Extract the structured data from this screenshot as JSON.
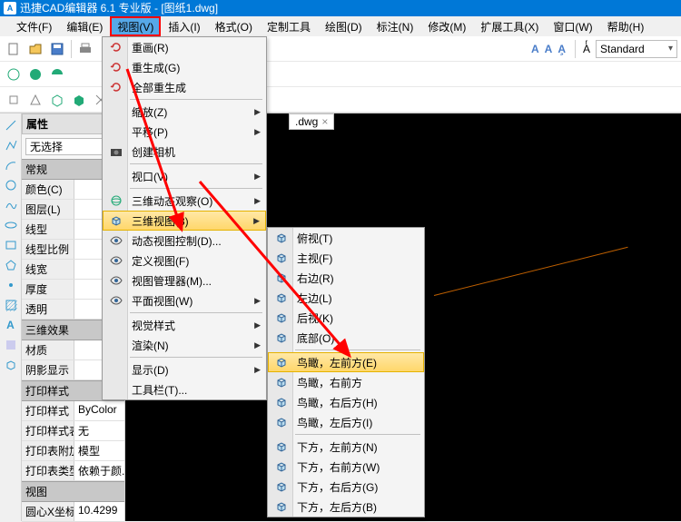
{
  "title": "迅捷CAD编辑器 6.1 专业版  - [图纸1.dwg]",
  "menubar": [
    "文件(F)",
    "编辑(E)",
    "视图(V)",
    "插入(I)",
    "格式(O)",
    "定制工具",
    "绘图(D)",
    "标注(N)",
    "修改(M)",
    "扩展工具(X)",
    "窗口(W)",
    "帮助(H)"
  ],
  "highlight_menu_index": 2,
  "style_combo": "Standard",
  "tab": {
    "label": ".dwg",
    "close": "×"
  },
  "props": {
    "panel_title": "属性",
    "noselect": "无选择",
    "sections": [
      {
        "head": "常规",
        "rows": [
          {
            "k": "颜色(C)",
            "v": ""
          },
          {
            "k": "图层(L)",
            "v": ""
          },
          {
            "k": "线型",
            "v": ""
          },
          {
            "k": "线型比例",
            "v": ""
          },
          {
            "k": "线宽",
            "v": ""
          },
          {
            "k": "厚度",
            "v": ""
          },
          {
            "k": "透明",
            "v": ""
          }
        ]
      },
      {
        "head": "三维效果",
        "rows": [
          {
            "k": "材质",
            "v": ""
          },
          {
            "k": "阴影显示",
            "v": ""
          }
        ]
      },
      {
        "head": "打印样式",
        "rows": [
          {
            "k": "打印样式",
            "v": "ByColor"
          },
          {
            "k": "打印样式表",
            "v": "无"
          },
          {
            "k": "打印表附加到",
            "v": "模型"
          },
          {
            "k": "打印表类型",
            "v": "依赖于颜..."
          }
        ]
      },
      {
        "head": "视图",
        "rows": [
          {
            "k": "圆心X坐标",
            "v": "10.4299"
          }
        ]
      }
    ]
  },
  "view_menu": {
    "items": [
      {
        "icon": "redo",
        "label": "重画(R)"
      },
      {
        "icon": "regen",
        "label": "重生成(G)"
      },
      {
        "icon": "regenall",
        "label": "全部重生成"
      },
      {
        "sep": true
      },
      {
        "icon": "",
        "label": "缩放(Z)",
        "sub": true
      },
      {
        "icon": "",
        "label": "平移(P)",
        "sub": true
      },
      {
        "icon": "camera",
        "label": "创建相机"
      },
      {
        "sep": true
      },
      {
        "icon": "",
        "label": "视口(V)",
        "sub": true
      },
      {
        "sep": true
      },
      {
        "icon": "orbit",
        "label": "三维动态观察(O)",
        "sub": true
      },
      {
        "icon": "3dview",
        "label": "三维视图(3)",
        "sub": true,
        "hi": true
      },
      {
        "icon": "dynview",
        "label": "动态视图控制(D)..."
      },
      {
        "icon": "defview",
        "label": "定义视图(F)"
      },
      {
        "icon": "viewmgr",
        "label": "视图管理器(M)..."
      },
      {
        "icon": "flatview",
        "label": "平面视图(W)",
        "sub": true
      },
      {
        "sep": true
      },
      {
        "icon": "",
        "label": "视觉样式",
        "sub": true
      },
      {
        "icon": "",
        "label": "渲染(N)",
        "sub": true
      },
      {
        "sep": true
      },
      {
        "icon": "",
        "label": "显示(D)",
        "sub": true
      },
      {
        "icon": "",
        "label": "工具栏(T)..."
      }
    ]
  },
  "sub_menu": {
    "items": [
      {
        "icon": "cube",
        "label": "俯视(T)"
      },
      {
        "icon": "cube",
        "label": "主视(F)"
      },
      {
        "icon": "cube",
        "label": "右边(R)"
      },
      {
        "icon": "cube",
        "label": "左边(L)"
      },
      {
        "icon": "cube",
        "label": "后视(K)"
      },
      {
        "icon": "cube",
        "label": "底部(O)"
      },
      {
        "sep": true
      },
      {
        "icon": "cube",
        "label": "鸟瞰，左前方(E)",
        "hi": true
      },
      {
        "icon": "cube",
        "label": "鸟瞰，右前方"
      },
      {
        "icon": "cube",
        "label": "鸟瞰，右后方(H)"
      },
      {
        "icon": "cube",
        "label": "鸟瞰，左后方(I)"
      },
      {
        "sep": true
      },
      {
        "icon": "cube",
        "label": "下方，左前方(N)"
      },
      {
        "icon": "cube",
        "label": "下方，右前方(W)"
      },
      {
        "icon": "cube",
        "label": "下方，右后方(G)"
      },
      {
        "icon": "cube",
        "label": "下方，左后方(B)"
      }
    ]
  }
}
